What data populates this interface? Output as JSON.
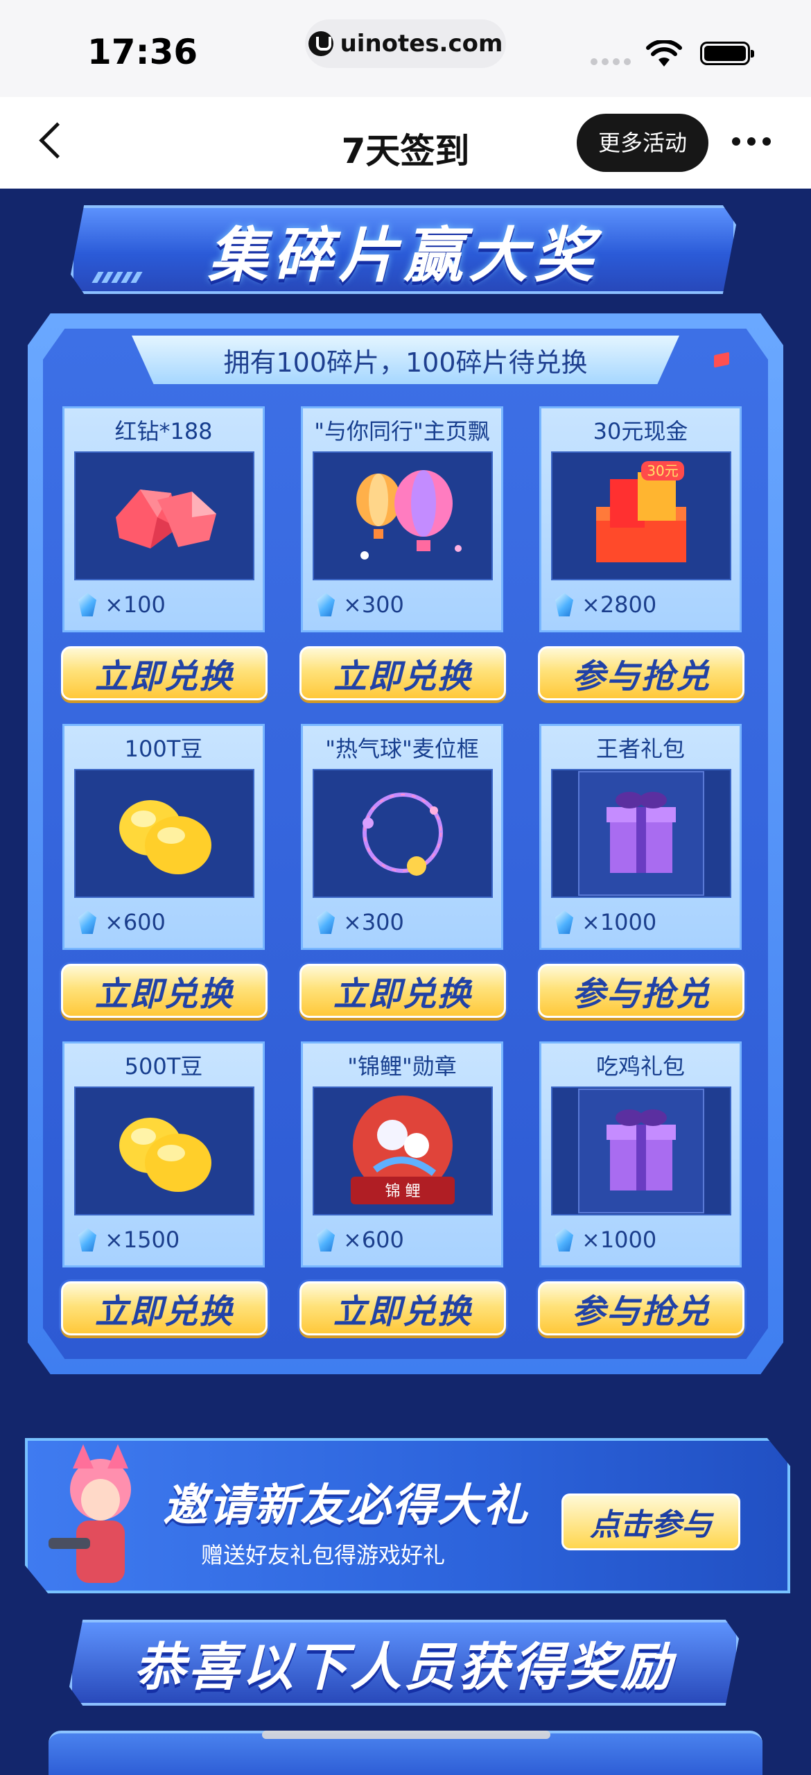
{
  "status_bar": {
    "time": "17:36",
    "url": "uinotes.com"
  },
  "nav": {
    "title": "7天签到",
    "more_activities": "更多活动"
  },
  "header_banner": {
    "title": "集碎片赢大奖"
  },
  "fragments": {
    "summary": "拥有100碎片，100碎片待兑换"
  },
  "rewards": [
    {
      "title": "红钻*188",
      "cost": "×100",
      "button": "立即兑换",
      "icon": "red-diamond-icon"
    },
    {
      "title": "\"与你同行\"主页飘",
      "cost": "×300",
      "button": "立即兑换",
      "icon": "hot-air-balloon-icon"
    },
    {
      "title": "30元现金",
      "cost": "×2800",
      "button": "参与抢兑",
      "icon": "red-envelope-icon",
      "tag": "30元"
    },
    {
      "title": "100T豆",
      "cost": "×600",
      "button": "立即兑换",
      "icon": "golden-bean-icon"
    },
    {
      "title": "\"热气球\"麦位框",
      "cost": "×300",
      "button": "立即兑换",
      "icon": "mic-frame-icon"
    },
    {
      "title": "王者礼包",
      "cost": "×1000",
      "button": "参与抢兑",
      "icon": "gift-box-icon"
    },
    {
      "title": "500T豆",
      "cost": "×1500",
      "button": "立即兑换",
      "icon": "golden-bean-icon"
    },
    {
      "title": "\"锦鲤\"勋章",
      "cost": "×600",
      "button": "立即兑换",
      "icon": "koi-badge-icon",
      "badge_text": "锦 鲤"
    },
    {
      "title": "吃鸡礼包",
      "cost": "×1000",
      "button": "参与抢兑",
      "icon": "gift-box-icon"
    }
  ],
  "invite_banner": {
    "title": "邀请新友必得大礼",
    "subtitle": "赠送好友礼包得游戏好礼",
    "cta": "点击参与"
  },
  "winners_banner": {
    "title": "恭喜以下人员获得奖励"
  },
  "colors": {
    "page_bg": "#13266c",
    "panel": "#2d5ad3",
    "button_gold": "#ffd64e",
    "text_dark_blue": "#173e8e"
  }
}
